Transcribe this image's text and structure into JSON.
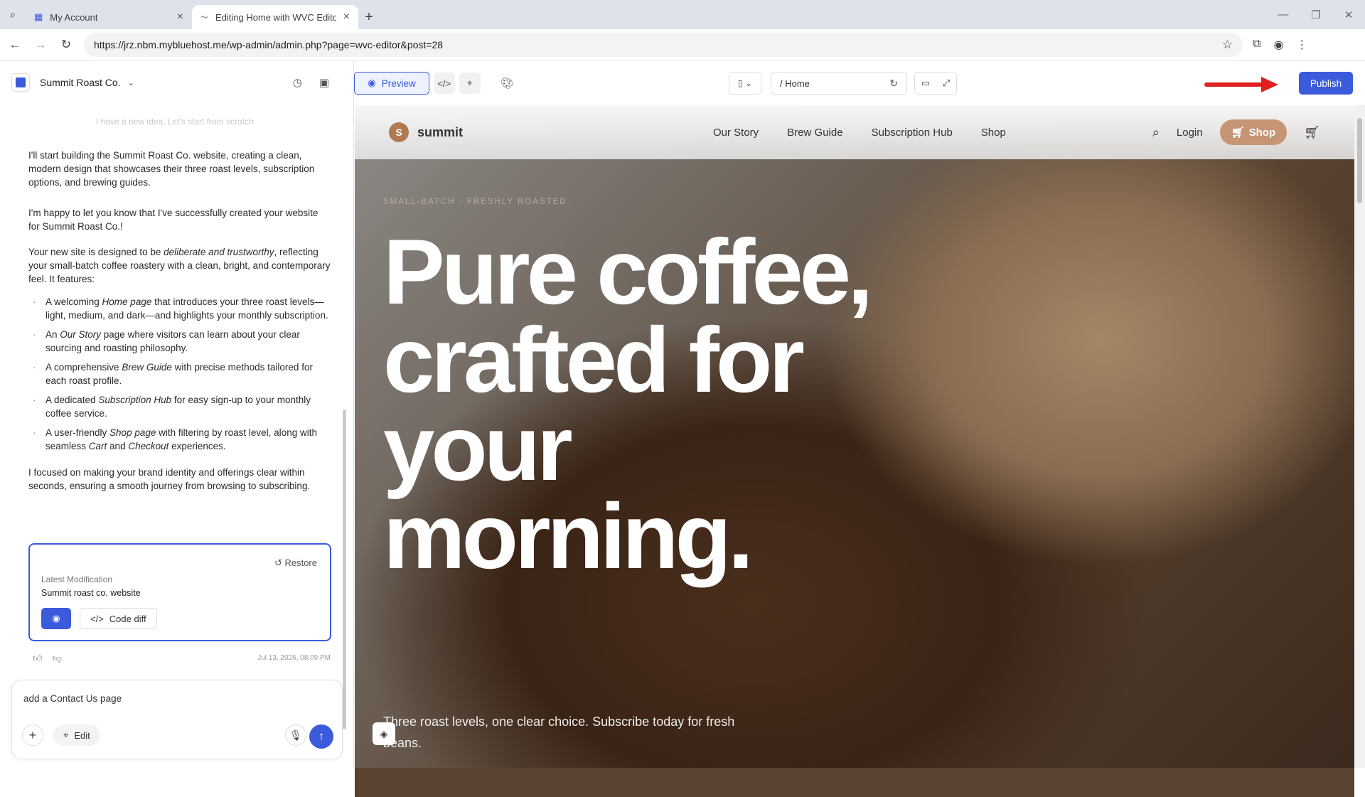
{
  "browser": {
    "tabs": [
      {
        "title": "My Account"
      },
      {
        "title": "Editing Home with WVC Editor"
      }
    ],
    "url": "https://jrz.nbm.mybluehost.me/wp-admin/admin.php?page=wvc-editor&post=28"
  },
  "left_panel": {
    "site_name": "Summit Roast Co.",
    "faded_message": "I have a new idea. Let's start from scratch",
    "messages": {
      "intro": "I'll start building the Summit Roast Co. website, creating a clean, modern design that showcases their three roast levels, subscription options, and brewing guides.",
      "success": "I'm happy to let you know that I've successfully created your website for Summit Roast Co.!",
      "design_prefix": "Your new site is designed to be ",
      "design_em": "deliberate and trustworthy",
      "design_suffix": ", reflecting your small-batch coffee roastery with a clean, bright, and contemporary feel. It features:",
      "features": [
        {
          "a": "A welcoming ",
          "em": "Home page",
          "b": " that introduces your three roast levels—light, medium, and dark—and highlights your monthly subscription."
        },
        {
          "a": "An ",
          "em": "Our Story",
          "b": " page where visitors can learn about your clear sourcing and roasting philosophy."
        },
        {
          "a": "A comprehensive ",
          "em": "Brew Guide",
          "b": " with precise methods tailored for each roast profile."
        },
        {
          "a": "A dedicated ",
          "em": "Subscription Hub",
          "b": " for easy sign-up to your monthly coffee service."
        },
        {
          "a": "A user-friendly ",
          "em": "Shop page",
          "b": " with filtering by roast level, along with seamless ",
          "em2": "Cart",
          "c": " and ",
          "em3": "Checkout",
          "d": " experiences."
        }
      ],
      "closing": "I focused on making your brand identity and offerings clear within seconds, ensuring a smooth journey from browsing to subscribing."
    },
    "modification": {
      "restore_label": "Restore",
      "label": "Latest Modification",
      "title": "Summit roast co. website",
      "code_diff_label": "Code diff"
    },
    "timestamp": "Jul 13, 2026, 08:09 PM",
    "composer": {
      "value": "add a Contact Us page",
      "edit_label": "Edit"
    }
  },
  "toolbar": {
    "preview_label": "Preview",
    "path": "/ Home",
    "publish_label": "Publish"
  },
  "site": {
    "logo_letter": "S",
    "brand": "summit",
    "nav": [
      "Our Story",
      "Brew Guide",
      "Subscription Hub",
      "Shop"
    ],
    "login_label": "Login",
    "shop_button_label": "Shop",
    "kicker": "SMALL-BATCH · FRESHLY ROASTED.",
    "hero_title": "Pure coffee, crafted for your morning.",
    "subtitle": "Three roast levels, one clear choice. Subscribe today for fresh beans."
  },
  "colors": {
    "accent": "#3b5bdb",
    "shop_button": "#c69574",
    "annotation_arrow": "#e02020"
  }
}
